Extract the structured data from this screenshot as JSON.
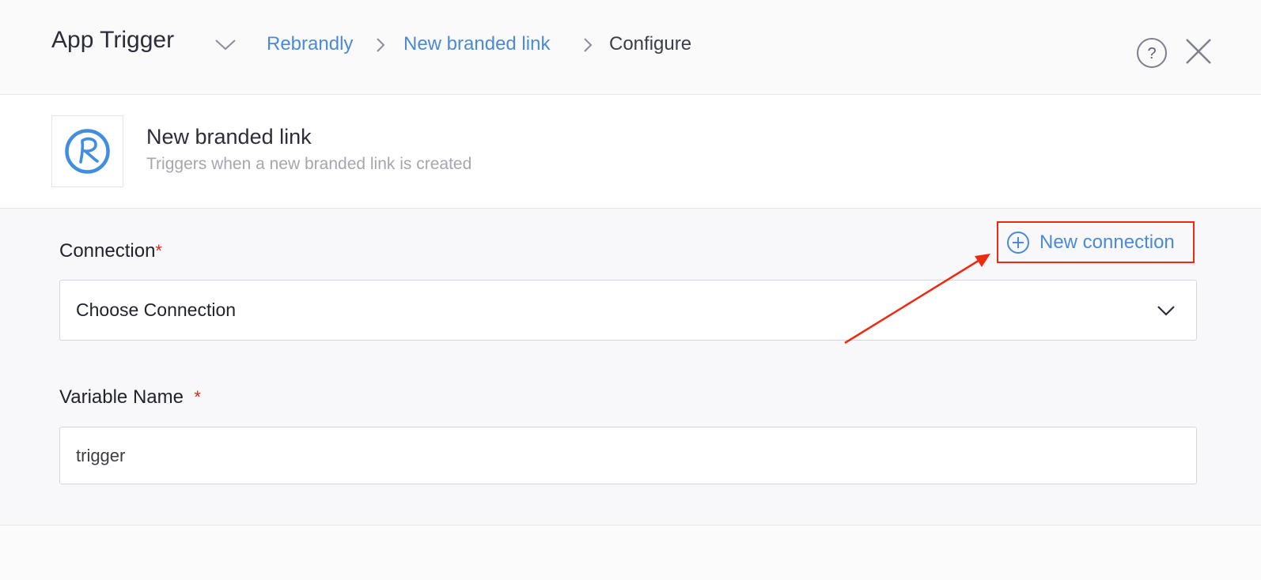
{
  "header": {
    "title": "App Trigger",
    "breadcrumb": [
      "Rebrandly",
      "New branded link",
      "Configure"
    ],
    "help_icon": "question-circle-icon",
    "close_icon": "close-x-icon"
  },
  "trigger": {
    "logo": "rebrandly-logo",
    "name": "New branded link",
    "description": "Triggers when a new branded link is created"
  },
  "form": {
    "connection_label": "Connection",
    "required_mark": "*",
    "new_connection_label": "New connection",
    "connection_select_value": "Choose Connection",
    "variable_label": "Variable Name",
    "variable_value": "trigger"
  },
  "colors": {
    "accent": "#4a8ad6",
    "required": "#e3271c",
    "highlight": "#ef2a12"
  }
}
